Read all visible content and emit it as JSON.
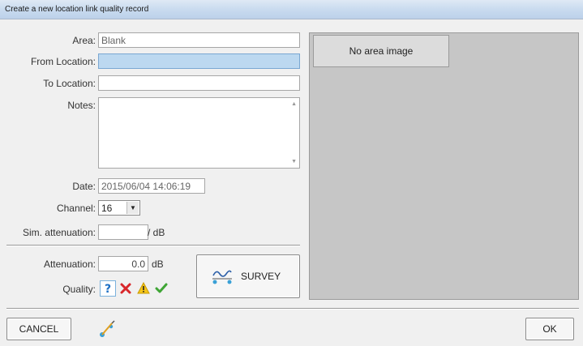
{
  "window": {
    "title": "Create a new location link quality record"
  },
  "form": {
    "area_label": "Area:",
    "area_value": "Blank",
    "from_location_label": "From Location:",
    "from_location_value": "",
    "to_location_label": "To Location:",
    "to_location_value": "",
    "notes_label": "Notes:",
    "notes_value": "",
    "date_label": "Date:",
    "date_value": "2015/06/04 14:06:19",
    "channel_label": "Channel:",
    "channel_value": "16",
    "sim_attenuation_label": "Sim. attenuation:",
    "sim_attenuation_value": "",
    "sim_attenuation_unit": "/ dB",
    "attenuation_label": "Attenuation:",
    "attenuation_value": "0.0",
    "attenuation_unit": "dB",
    "quality_label": "Quality:"
  },
  "quality_buttons": [
    {
      "name": "unknown",
      "icon": "question-icon",
      "selected": true
    },
    {
      "name": "bad",
      "icon": "red-x-icon",
      "selected": false
    },
    {
      "name": "warning",
      "icon": "warning-triangle-icon",
      "selected": false
    },
    {
      "name": "good",
      "icon": "green-check-icon",
      "selected": false
    }
  ],
  "survey_button": {
    "label": "SURVEY",
    "icon": "signal-graph-icon"
  },
  "image_panel": {
    "placeholder": "No area image"
  },
  "footer": {
    "cancel_label": "CANCEL",
    "ok_label": "OK",
    "tool_icon": "link-tool-icon"
  },
  "colors": {
    "focused_field": "#bcd8f0",
    "image_area_bg": "#c6c6c6",
    "titlebar": "#c9dbef"
  }
}
